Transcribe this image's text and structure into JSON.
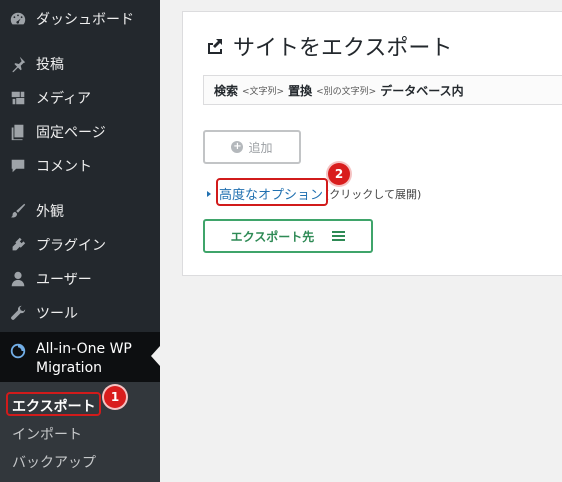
{
  "sidebar": {
    "items": [
      {
        "label": "ダッシュボード",
        "icon": "dashboard-icon"
      },
      {
        "label": "投稿",
        "icon": "pin-icon"
      },
      {
        "label": "メディア",
        "icon": "media-icon"
      },
      {
        "label": "固定ページ",
        "icon": "page-icon"
      },
      {
        "label": "コメント",
        "icon": "comment-icon"
      },
      {
        "label": "外観",
        "icon": "brush-icon"
      },
      {
        "label": "プラグイン",
        "icon": "plugin-icon"
      },
      {
        "label": "ユーザー",
        "icon": "user-icon"
      },
      {
        "label": "ツール",
        "icon": "wrench-icon"
      }
    ],
    "plugin": {
      "line1": "All-in-One WP",
      "line2": "Migration",
      "icon": "migration-icon"
    },
    "submenu": [
      "エクスポート",
      "インポート",
      "バックアップ"
    ]
  },
  "annotations": {
    "step1": "1",
    "step2": "2",
    "highlight_color": "#d11b1b"
  },
  "main": {
    "title": "サイトをエクスポート",
    "search": {
      "search_label": "検索",
      "search_hint": "<文字列>",
      "replace_label": "置換",
      "replace_hint": "<別の文字列>",
      "scope_label": "データベース内"
    },
    "add_label": "追加",
    "advanced_link": "高度なオプション",
    "advanced_note": "(クリックして展開)",
    "export_to_label": "エクスポート先"
  },
  "colors": {
    "sidebar_bg": "#23282d",
    "accent_green": "#3fa46a",
    "link_blue": "#2271b1"
  }
}
